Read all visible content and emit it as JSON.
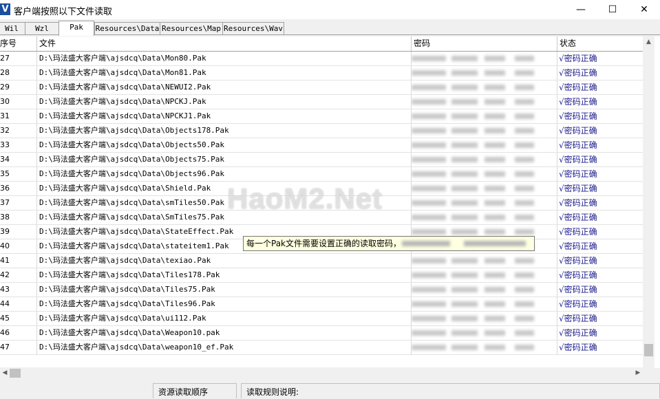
{
  "window": {
    "icon_letter": "V",
    "title": "客户端按照以下文件读取",
    "minimize": "—",
    "maximize": "☐",
    "close": "✕"
  },
  "tabs": [
    {
      "label": "Wil",
      "active": false
    },
    {
      "label": "Wzl",
      "active": false
    },
    {
      "label": "Pak",
      "active": true
    },
    {
      "label": "Resources\\Data",
      "active": false
    },
    {
      "label": "Resources\\Map",
      "active": false
    },
    {
      "label": "Resources\\Wav",
      "active": false
    }
  ],
  "table": {
    "columns": {
      "index": "序号",
      "file": "文件",
      "password": "密码",
      "status": "状态"
    },
    "rows": [
      {
        "index": "27",
        "file": "D:\\玛法盛大客户端\\ajsdcq\\Data\\Mon80.Pak",
        "status": "√密码正确"
      },
      {
        "index": "28",
        "file": "D:\\玛法盛大客户端\\ajsdcq\\Data\\Mon81.Pak",
        "status": "√密码正确"
      },
      {
        "index": "29",
        "file": "D:\\玛法盛大客户端\\ajsdcq\\Data\\NEWUI2.Pak",
        "status": "√密码正确"
      },
      {
        "index": "30",
        "file": "D:\\玛法盛大客户端\\ajsdcq\\Data\\NPCKJ.Pak",
        "status": "√密码正确"
      },
      {
        "index": "31",
        "file": "D:\\玛法盛大客户端\\ajsdcq\\Data\\NPCKJ1.Pak",
        "status": "√密码正确"
      },
      {
        "index": "32",
        "file": "D:\\玛法盛大客户端\\ajsdcq\\Data\\Objects178.Pak",
        "status": "√密码正确"
      },
      {
        "index": "33",
        "file": "D:\\玛法盛大客户端\\ajsdcq\\Data\\Objects50.Pak",
        "status": "√密码正确"
      },
      {
        "index": "34",
        "file": "D:\\玛法盛大客户端\\ajsdcq\\Data\\Objects75.Pak",
        "status": "√密码正确"
      },
      {
        "index": "35",
        "file": "D:\\玛法盛大客户端\\ajsdcq\\Data\\Objects96.Pak",
        "status": "√密码正确"
      },
      {
        "index": "36",
        "file": "D:\\玛法盛大客户端\\ajsdcq\\Data\\Shield.Pak",
        "status": "√密码正确"
      },
      {
        "index": "37",
        "file": "D:\\玛法盛大客户端\\ajsdcq\\Data\\smTiles50.Pak",
        "status": "√密码正确"
      },
      {
        "index": "38",
        "file": "D:\\玛法盛大客户端\\ajsdcq\\Data\\SmTiles75.Pak",
        "status": "√密码正确"
      },
      {
        "index": "39",
        "file": "D:\\玛法盛大客户端\\ajsdcq\\Data\\StateEffect.Pak",
        "status": "√密码正确"
      },
      {
        "index": "40",
        "file": "D:\\玛法盛大客户端\\ajsdcq\\Data\\stateitem1.Pak",
        "status": "√密码正确"
      },
      {
        "index": "41",
        "file": "D:\\玛法盛大客户端\\ajsdcq\\Data\\texiao.Pak",
        "status": "√密码正确"
      },
      {
        "index": "42",
        "file": "D:\\玛法盛大客户端\\ajsdcq\\Data\\Tiles178.Pak",
        "status": "√密码正确"
      },
      {
        "index": "43",
        "file": "D:\\玛法盛大客户端\\ajsdcq\\Data\\Tiles75.Pak",
        "status": "√密码正确"
      },
      {
        "index": "44",
        "file": "D:\\玛法盛大客户端\\ajsdcq\\Data\\Tiles96.Pak",
        "status": "√密码正确"
      },
      {
        "index": "45",
        "file": "D:\\玛法盛大客户端\\ajsdcq\\Data\\ui112.Pak",
        "status": "√密码正确"
      },
      {
        "index": "46",
        "file": "D:\\玛法盛大客户端\\ajsdcq\\Data\\Weapon10.pak",
        "status": "√密码正确"
      },
      {
        "index": "47",
        "file": "D:\\玛法盛大客户端\\ajsdcq\\Data\\weapon10_ef.Pak",
        "status": "√密码正确"
      }
    ]
  },
  "tooltip": {
    "text": "每一个Pak文件需要设置正确的读取密码，"
  },
  "watermark": "HaoM2.Net",
  "bottom": {
    "load_order_label": "资源读取顺序",
    "rules_label": "读取规则说明:"
  },
  "scroll": {
    "up": "▲",
    "left": "◀",
    "right": "▶"
  },
  "colors": {
    "status_text": "#1a1a8c",
    "tooltip_bg": "#ffffe1",
    "app_icon": "#1a4fa0"
  }
}
